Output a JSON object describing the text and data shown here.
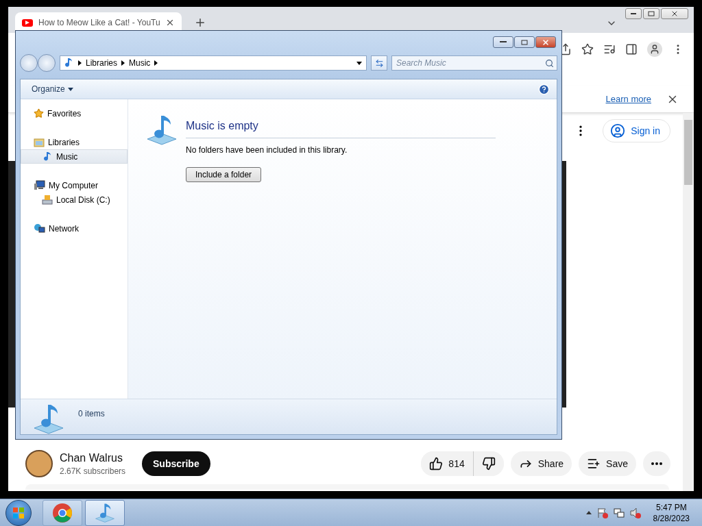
{
  "browser": {
    "tab": {
      "title": "How to Meow Like a Cat! - YouTu",
      "selected": true
    },
    "infobar": {
      "link": "Learn more"
    },
    "sign_in": "Sign in",
    "channel": {
      "name": "Chan Walrus",
      "subscribers": "2.67K subscribers"
    },
    "subscribe": "Subscribe",
    "actions": [
      {
        "kind": "like",
        "label": "814"
      },
      {
        "kind": "share",
        "label": "Share"
      },
      {
        "kind": "save",
        "label": "Save"
      }
    ]
  },
  "explorer": {
    "breadcrumb": [
      "Libraries",
      "Music"
    ],
    "search": {
      "placeholder": "Search Music"
    },
    "organize": "Organize",
    "nav": [
      {
        "label": "Favorites",
        "kind": "star",
        "selected": false
      },
      {
        "label": "Libraries",
        "kind": "library",
        "selected": false,
        "children": [
          {
            "label": "Music",
            "kind": "music",
            "selected": true
          }
        ]
      },
      {
        "label": "My Computer",
        "kind": "computer",
        "selected": false,
        "children": [
          {
            "label": "Local Disk (C:)",
            "kind": "disk",
            "selected": false
          }
        ]
      },
      {
        "label": "Network",
        "kind": "network",
        "selected": false
      }
    ],
    "empty": {
      "title": "Music is empty",
      "message": "No folders have been included in this library.",
      "button": "Include a folder"
    },
    "status": "0 items"
  },
  "taskbar": {
    "apps": [
      {
        "kind": "chrome",
        "selected": false
      },
      {
        "kind": "explorer",
        "selected": true
      }
    ],
    "clock": {
      "time": "5:47 PM",
      "date": "8/28/2023"
    }
  }
}
